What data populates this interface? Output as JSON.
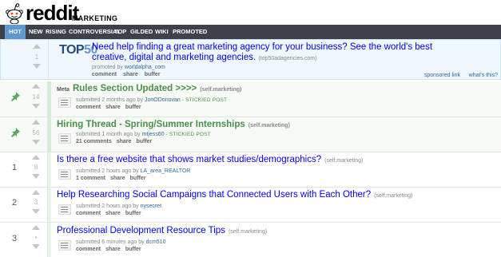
{
  "header": {
    "logo_text": "reddit",
    "subreddit": "MARKETING",
    "tabs": [
      "HOT",
      "NEW",
      "RISING",
      "CONTROVERSIAL",
      "TOP",
      "GILDED",
      "WIKI",
      "PROMOTED"
    ],
    "active_tab": "HOT"
  },
  "promoted": {
    "logo_main": "TOP",
    "logo_num": "50",
    "title": "Need help finding a great marketing agency for your business? See the world's best creative, digital and marketing agencies.",
    "domain": "(top50adagencies.com)",
    "promoted_by_prefix": "promoted by",
    "promoted_by": "worldalpha_com",
    "score": "1",
    "actions": [
      "comment",
      "share",
      "buffer"
    ],
    "sponsored_link": "sponsored link",
    "whats_this": "what's this?"
  },
  "posts": [
    {
      "rank": "",
      "score": "14",
      "flair": "Meta",
      "title": "Rules Section Updated >>>>",
      "domain": "(self.marketing)",
      "submitted": "submitted 2 months ago by",
      "author": "JonODonovan",
      "sticky_label": "- STICKIED POST",
      "actions": [
        "comment",
        "share",
        "buffer"
      ],
      "sticky": true
    },
    {
      "rank": "",
      "score": "56",
      "flair": "",
      "title": "Hiring Thread - Spring/Summer Internships",
      "domain": "(self.marketing)",
      "submitted": "submitted 1 month ago by",
      "author": "mtjess60",
      "sticky_label": "- STICKIED POST",
      "actions": [
        "21 comments",
        "share",
        "buffer"
      ],
      "sticky": true
    },
    {
      "rank": "1",
      "score": "8",
      "flair": "",
      "title": "Is there a free website that shows market studies/demographics?",
      "domain": "(self.marketing)",
      "submitted": "submitted 2 hours ago by",
      "author": "LA_area_REALTOR",
      "sticky_label": "",
      "actions": [
        "1 comment",
        "share",
        "buffer"
      ],
      "sticky": false
    },
    {
      "rank": "2",
      "score": "3",
      "flair": "",
      "title": "Help Researching Social Campaigns that Connected Users with Each Other?",
      "domain": "(self.marketing)",
      "submitted": "submitted 2 hours ago by",
      "author": "nysecret",
      "sticky_label": "",
      "actions": [
        "comment",
        "share",
        "buffer"
      ],
      "sticky": false
    },
    {
      "rank": "3",
      "score": "•",
      "flair": "",
      "title": "Professional Development Resource Tips",
      "domain": "(self.marketing)",
      "submitted": "submitted 6 minutes ago by",
      "author": "dcm510",
      "sticky_label": "",
      "actions": [
        "comment",
        "share",
        "buffer"
      ],
      "sticky": false
    }
  ],
  "colors": {
    "tabbar": "#3e4147",
    "active_tab": "#5f99cf",
    "sticky_green": "#4a8f4a",
    "link_blue": "#0000ff"
  }
}
